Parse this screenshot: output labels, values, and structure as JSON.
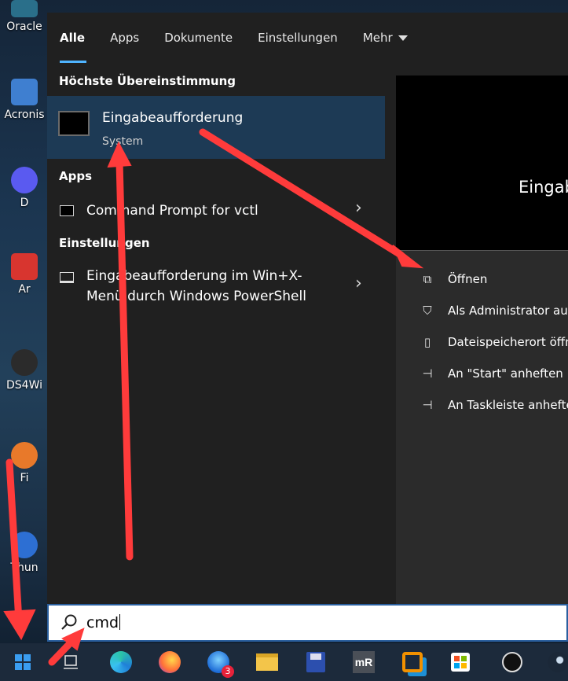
{
  "desktop": {
    "icons": [
      {
        "label": "Oracle"
      },
      {
        "label": "Acronis"
      },
      {
        "label": "D"
      },
      {
        "label": "Ar"
      },
      {
        "label": "DS4Wi"
      },
      {
        "label": "Fi"
      },
      {
        "label": "Thun"
      }
    ]
  },
  "tabs": [
    {
      "label": "Alle"
    },
    {
      "label": "Apps"
    },
    {
      "label": "Dokumente"
    },
    {
      "label": "Einstellungen"
    },
    {
      "label": "Mehr"
    }
  ],
  "best_match": {
    "section_title": "Höchste Übereinstimmung",
    "title": "Eingabeaufforderung",
    "subtitle": "System",
    "icon": "cmd-console-icon"
  },
  "apps": {
    "section_title": "Apps",
    "items": [
      {
        "label": "Command Prompt for vctl",
        "icon": "console-icon"
      }
    ]
  },
  "settings": {
    "section_title": "Einstellungen",
    "items": [
      {
        "line1": "Eingabeaufforderung im Win+X-",
        "line2": "Menü durch Windows PowerShell",
        "icon": "laptop-icon"
      }
    ]
  },
  "preview": {
    "title": "Eingab",
    "actions": [
      {
        "label": "Öffnen",
        "icon": "open-icon"
      },
      {
        "label": "Als Administrator aus",
        "icon": "shield-icon"
      },
      {
        "label": "Dateispeicherort öffne",
        "icon": "folder-icon"
      },
      {
        "label": "An \"Start\" anheften",
        "icon": "pin-icon"
      },
      {
        "label": "An Taskleiste anhefter",
        "icon": "pin-icon"
      }
    ]
  },
  "search": {
    "value": "cmd",
    "icon": "search-icon"
  },
  "taskbar": {
    "items": [
      {
        "name": "start-icon"
      },
      {
        "name": "task-view-icon"
      },
      {
        "name": "edge-icon"
      },
      {
        "name": "firefox-icon"
      },
      {
        "name": "thunderbird-icon",
        "badge": "3"
      },
      {
        "name": "file-explorer-icon"
      },
      {
        "name": "save-disk-icon"
      },
      {
        "name": "mremoteng-icon"
      },
      {
        "name": "vmware-icon"
      },
      {
        "name": "store-icon"
      },
      {
        "name": "app-icon"
      },
      {
        "name": "steam-icon"
      }
    ]
  },
  "colors": {
    "accent": "#4fb4ff",
    "selected_row": "#1d3a55",
    "panel": "#202020",
    "arrow": "#ff3b3b"
  }
}
